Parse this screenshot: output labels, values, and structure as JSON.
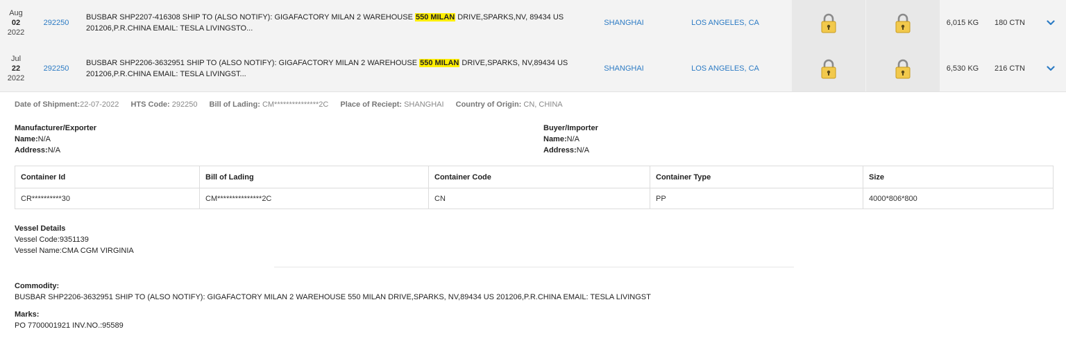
{
  "rows": [
    {
      "month": "Aug",
      "day": "02",
      "year": "2022",
      "hts": "292250",
      "desc_before": "BUSBAR SHP2207-416308 SHIP TO (ALSO NOTIFY): GIGAFACTORY MILAN 2 WAREHOUSE ",
      "desc_highlight": "550 MILAN",
      "desc_after": " DRIVE,SPARKS,NV, 89434 US 201206,P.R.CHINA EMAIL: TESLA LIVINGSTO...",
      "origin": "SHANGHAI",
      "destination": "LOS ANGELES, CA",
      "weight": "6,015 KG",
      "quantity": "180 CTN"
    },
    {
      "month": "Jul",
      "day": "22",
      "year": "2022",
      "hts": "292250",
      "desc_before": "BUSBAR SHP2206-3632951 SHIP TO (ALSO NOTIFY): GIGAFACTORY MILAN 2 WAREHOUSE ",
      "desc_highlight": "550 MILAN",
      "desc_after": " DRIVE,SPARKS, NV,89434 US 201206,P.R.CHINA EMAIL: TESLA LIVINGST...",
      "origin": "SHANGHAI",
      "destination": "LOS ANGELES, CA",
      "weight": "6,530 KG",
      "quantity": "216 CTN"
    }
  ],
  "detail": {
    "meta": {
      "date_label": "Date of Shipment:",
      "date_value": "22-07-2022",
      "hts_label": "HTS Code:",
      "hts_value": "292250",
      "bol_label": "Bill of Lading:",
      "bol_value": "CM***************2C",
      "receipt_label": "Place of Reciept:",
      "receipt_value": "SHANGHAI",
      "origin_label": "Country of Origin:",
      "origin_value": "CN, CHINA"
    },
    "manufacturer": {
      "heading": "Manufacturer/Exporter",
      "name_label": "Name:",
      "name_value": "N/A",
      "address_label": "Address:",
      "address_value": "N/A"
    },
    "buyer": {
      "heading": "Buyer/Importer",
      "name_label": "Name:",
      "name_value": "N/A",
      "address_label": "Address:",
      "address_value": "N/A"
    },
    "container_table": {
      "headers": [
        "Container Id",
        "Bill of Lading",
        "Container Code",
        "Container Type",
        "Size"
      ],
      "rows": [
        [
          "CR**********30",
          "CM***************2C",
          "CN",
          "PP",
          "4000*806*800"
        ]
      ]
    },
    "vessel": {
      "heading": "Vessel Details",
      "code_line": "Vessel Code:9351139",
      "name_line": "Vessel Name:CMA CGM VIRGINIA"
    },
    "commodity": {
      "heading": "Commodity:",
      "text": "BUSBAR SHP2206-3632951 SHIP TO (ALSO NOTIFY): GIGAFACTORY MILAN 2 WAREHOUSE 550 MILAN DRIVE,SPARKS, NV,89434 US 201206,P.R.CHINA EMAIL: TESLA LIVINGST"
    },
    "marks": {
      "heading": "Marks:",
      "text": "PO 7700001921 INV.NO.:95589"
    }
  },
  "icons": {
    "lock": "lock-icon",
    "expand": "chevron-down-icon"
  },
  "colors": {
    "link": "#2c7bc4",
    "highlight": "#ffee00",
    "lock_body": "#f2c94c"
  }
}
